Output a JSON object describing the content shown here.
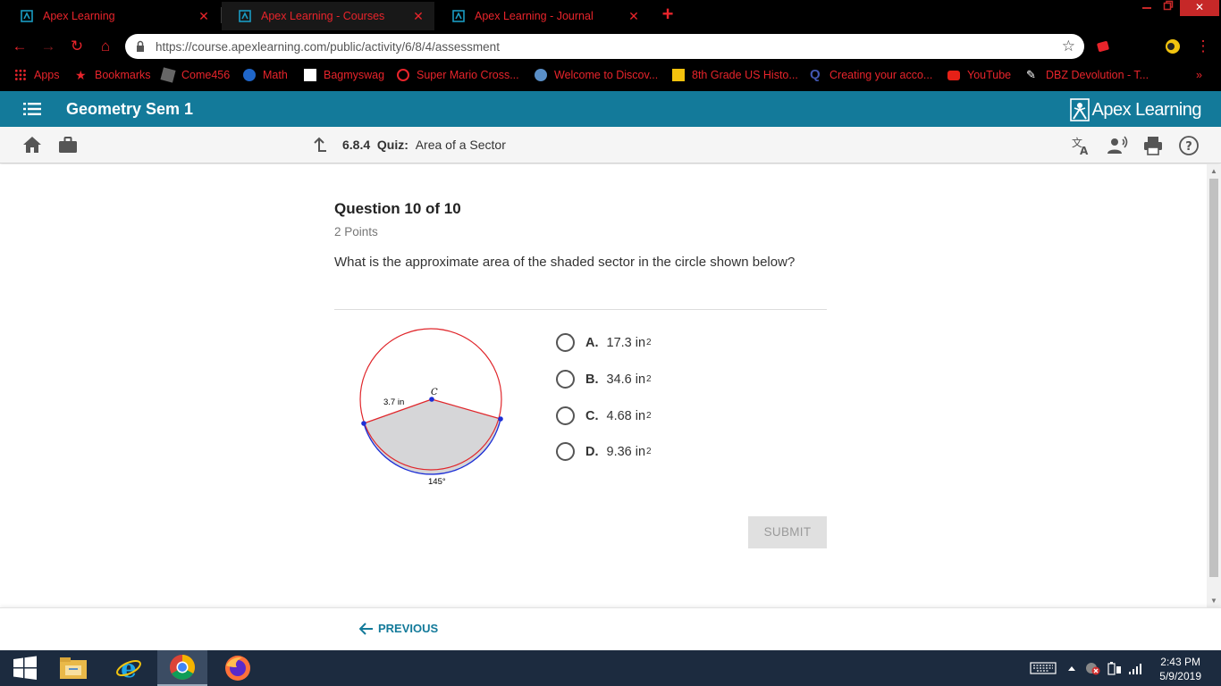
{
  "browser": {
    "tabs": [
      {
        "title": "Apex Learning",
        "active": false
      },
      {
        "title": "Apex Learning - Courses",
        "active": true
      },
      {
        "title": "Apex Learning - Journal",
        "active": false
      }
    ],
    "url": "https://course.apexlearning.com/public/activity/6/8/4/assessment",
    "bookmarks": [
      "Apps",
      "Bookmarks",
      "Come456",
      "Math",
      "Bagmyswag",
      "Super Mario Cross...",
      "Welcome to Discov...",
      "8th Grade US Histo...",
      "Creating your acco...",
      "YouTube",
      "DBZ Devolution - T..."
    ],
    "accent_color": "#e8242b"
  },
  "header": {
    "course_title": "Geometry Sem 1",
    "logo_text": "Apex Learning",
    "brand_color": "#137a9a"
  },
  "activity": {
    "code": "6.8.4",
    "type": "Quiz:",
    "name": "Area of a Sector"
  },
  "question": {
    "number_label": "Question 10 of 10",
    "points": "2 Points",
    "prompt": "What is the approximate area of the shaded sector in the circle shown below?",
    "figure": {
      "center_label": "C",
      "radius_label": "3.7 in",
      "arc_label": "145°"
    },
    "choices": [
      {
        "letter": "A.",
        "value": "17.3 in",
        "exp": "2"
      },
      {
        "letter": "B.",
        "value": "34.6 in",
        "exp": "2"
      },
      {
        "letter": "C.",
        "value": "4.68 in",
        "exp": "2"
      },
      {
        "letter": "D.",
        "value": "9.36 in",
        "exp": "2"
      }
    ],
    "submit_label": "SUBMIT"
  },
  "footer": {
    "previous_label": "PREVIOUS"
  },
  "taskbar": {
    "time": "2:43 PM",
    "date": "5/9/2019"
  }
}
